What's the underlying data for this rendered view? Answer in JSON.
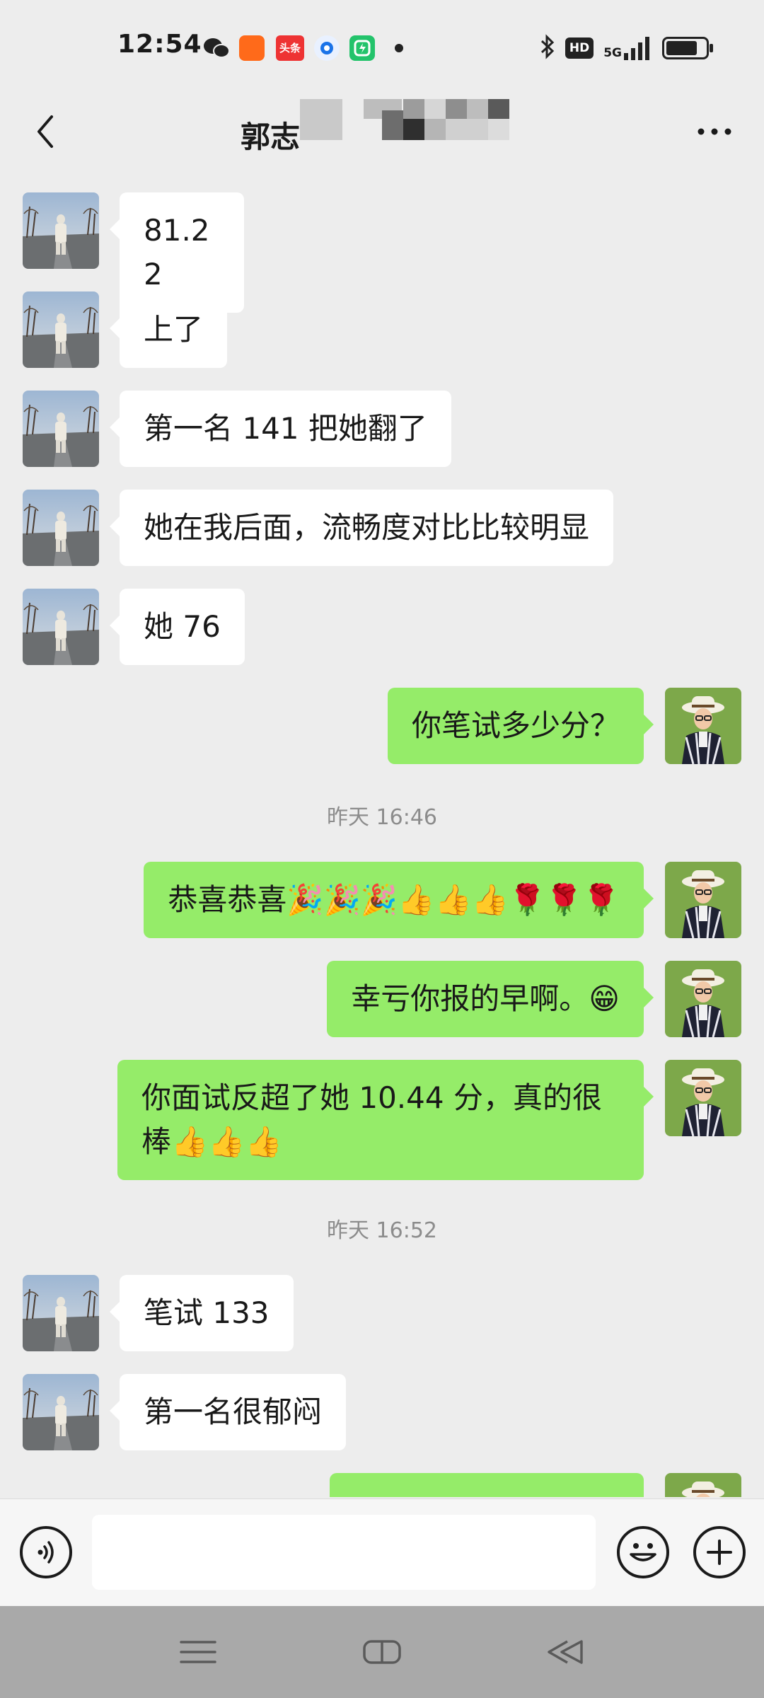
{
  "status_bar": {
    "time": "12:54",
    "network": "5G",
    "hd_badge": "HD",
    "toutiao_label": "头条",
    "battery_level": 0.9,
    "icons": [
      "wechat-icon",
      "kuaishou-icon",
      "toutiao-icon",
      "browser-icon",
      "app-icon",
      "bluetooth-icon",
      "signal-icon",
      "battery-icon"
    ]
  },
  "header": {
    "title": "郭志",
    "back_icon": "chevron-left-icon",
    "more_icon": "more-icon"
  },
  "messages": [
    {
      "side": "left",
      "text": "81.22"
    },
    {
      "side": "left",
      "text": "上了"
    },
    {
      "side": "left",
      "text": "第一名 141 把她翻了"
    },
    {
      "side": "left",
      "text": "她在我后面，流畅度对比比较明显"
    },
    {
      "side": "left",
      "text": "她 76"
    },
    {
      "side": "right",
      "text": "你笔试多少分？"
    },
    {
      "type": "time",
      "text": "昨天 16:46"
    },
    {
      "side": "right",
      "text": "恭喜恭喜🎉🎉🎉👍👍👍🌹🌹🌹"
    },
    {
      "side": "right",
      "text": "幸亏你报的早啊。😁"
    },
    {
      "side": "right",
      "text": "你面试反超了她 10.44 分，真的很棒👍👍👍"
    },
    {
      "type": "time",
      "text": "昨天 16:52"
    },
    {
      "side": "left",
      "text": "笔试 133"
    },
    {
      "side": "left",
      "text": "第一名很郁闷"
    }
  ],
  "input_bar": {
    "placeholder": "",
    "voice_icon": "voice-icon",
    "emoji_icon": "emoji-icon",
    "plus_icon": "plus-icon"
  },
  "nav_bar": {
    "icons": [
      "menu-icon",
      "home-icon",
      "back-icon"
    ]
  },
  "colors": {
    "background": "#ededed",
    "sent_bubble": "#95ec69",
    "received_bubble": "#ffffff"
  }
}
